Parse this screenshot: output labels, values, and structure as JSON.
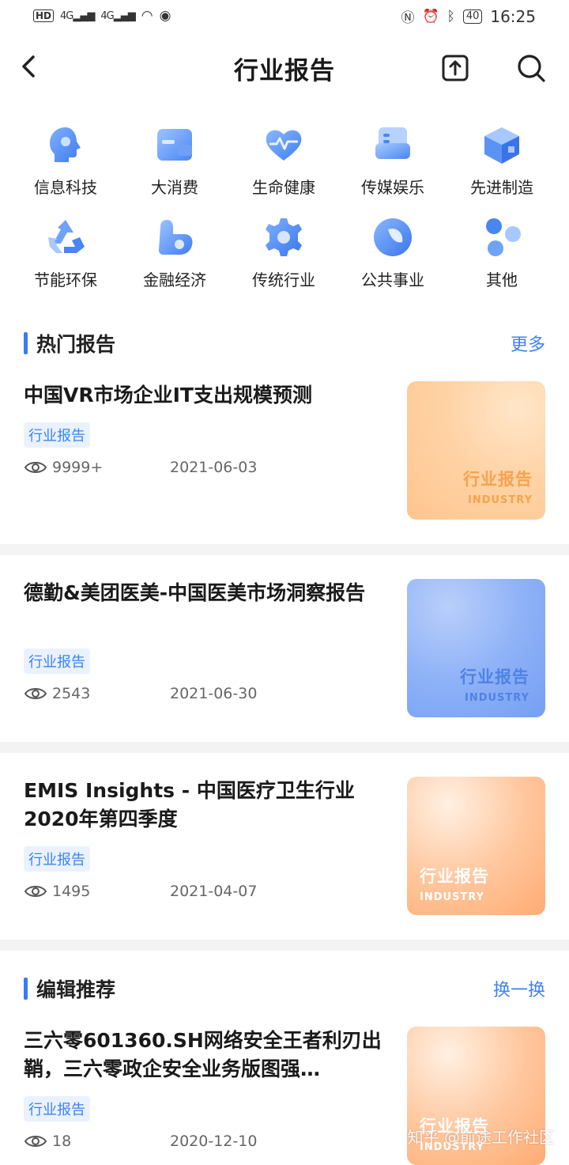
{
  "status_bar": {
    "hd": "HD",
    "signal_1": "4G",
    "signal_2": "4G",
    "battery": "40",
    "time": "16:25"
  },
  "header": {
    "title": "行业报告"
  },
  "categories": [
    {
      "label": "信息科技",
      "icon": "head-tech-icon"
    },
    {
      "label": "大消费",
      "icon": "card-consumer-icon"
    },
    {
      "label": "生命健康",
      "icon": "heart-health-icon"
    },
    {
      "label": "传媒娱乐",
      "icon": "media-icon"
    },
    {
      "label": "先进制造",
      "icon": "cube-manufacturing-icon"
    },
    {
      "label": "节能环保",
      "icon": "recycle-icon"
    },
    {
      "label": "金融经济",
      "icon": "finance-icon"
    },
    {
      "label": "传统行业",
      "icon": "gear-icon"
    },
    {
      "label": "公共事业",
      "icon": "public-icon"
    },
    {
      "label": "其他",
      "icon": "other-icon"
    }
  ],
  "hot_section": {
    "title": "热门报告",
    "more": "更多"
  },
  "editor_section": {
    "title": "编辑推荐",
    "more": "换一换"
  },
  "reports": [
    {
      "title": "中国VR市场企业IT支出规模预测",
      "tag": "行业报告",
      "views": "9999+",
      "date": "2021-06-03",
      "thumb_title": "行业报告",
      "thumb_sub": "INDUSTRY"
    },
    {
      "title": "德勤&美团医美-中国医美市场洞察报告",
      "tag": "行业报告",
      "views": "2543",
      "date": "2021-06-30",
      "thumb_title": "行业报告",
      "thumb_sub": "INDUSTRY"
    },
    {
      "title": "EMIS Insights - 中国医疗卫生行业2020年第四季度",
      "tag": "行业报告",
      "views": "1495",
      "date": "2021-04-07",
      "thumb_title": "行业报告",
      "thumb_sub": "INDUSTRY"
    },
    {
      "title": "三六零601360.SH网络安全王者利刃出鞘，三六零政企安全业务版图强…",
      "tag": "行业报告",
      "views": "18",
      "date": "2020-12-10",
      "thumb_title": "行业报告",
      "thumb_sub": "INDUSTRY"
    }
  ],
  "watermark": "知乎 @前途工作社区",
  "colors": {
    "accent": "#3b82f6",
    "tag_bg": "#eaf2ff"
  }
}
